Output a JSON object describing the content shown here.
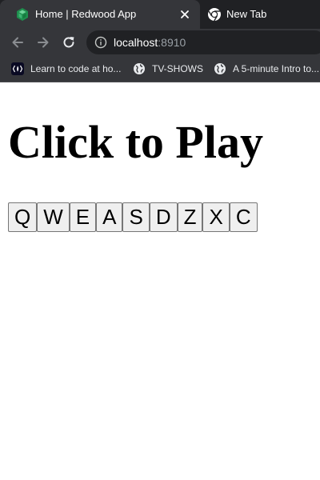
{
  "browser": {
    "tabs": [
      {
        "title": "Home | Redwood App",
        "active": true,
        "icon": "redwood-logo-icon"
      },
      {
        "title": "New Tab",
        "active": false,
        "icon": "chrome-icon"
      }
    ],
    "close_symbol": "✕",
    "address": {
      "host": "localhost",
      "port": ":8910"
    },
    "bookmarks": [
      {
        "label": "Learn to code at ho...",
        "icon": "freecodecamp-icon"
      },
      {
        "label": "TV-SHOWS",
        "icon": "globe-icon"
      },
      {
        "label": "A 5-minute Intro to...",
        "icon": "globe-icon"
      }
    ],
    "colors": {
      "tabstrip": "#202124",
      "toolbar": "#35363a",
      "redwood_green": "#2e8b57"
    }
  },
  "page": {
    "title": "Click to Play",
    "keys": [
      "Q",
      "W",
      "E",
      "A",
      "S",
      "D",
      "Z",
      "X",
      "C"
    ]
  }
}
